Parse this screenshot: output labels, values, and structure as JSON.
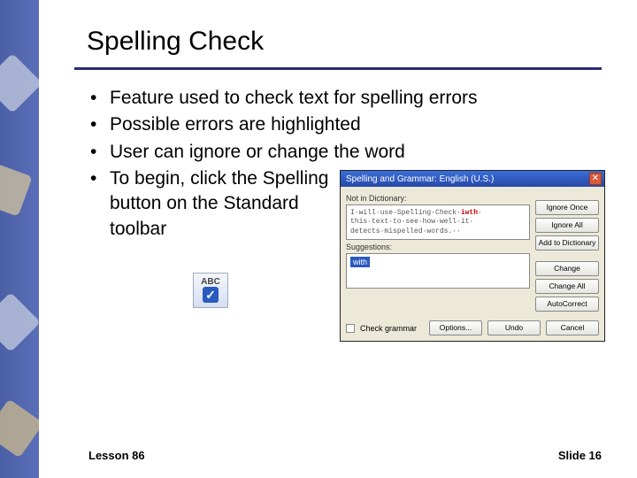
{
  "title": "Spelling Check",
  "bullets": [
    "Feature used to check text for spelling errors",
    "Possible errors are highlighted",
    "User can ignore or change the word",
    "To begin, click the Spelling button on the Standard toolbar"
  ],
  "spelling_icon": {
    "label": "ABC"
  },
  "dialog": {
    "title": "Spelling and Grammar: English (U.S.)",
    "not_in_dict_label": "Not in Dictionary:",
    "sentence_pre": "I·will·use·Spelling·Check·",
    "sentence_err": "iwth",
    "sentence_post": "· this·text·to·see·how·well·it· detects·mispelled·words.··",
    "suggestions_label": "Suggestions:",
    "suggestion": "with",
    "buttons_right": [
      "Ignore Once",
      "Ignore All",
      "Add to Dictionary",
      "Change",
      "Change All",
      "AutoCorrect"
    ],
    "check_grammar": "Check grammar",
    "bottom_buttons": [
      "Options...",
      "Undo",
      "Cancel"
    ]
  },
  "footer": {
    "lesson": "Lesson 86",
    "slide": "Slide 16"
  }
}
